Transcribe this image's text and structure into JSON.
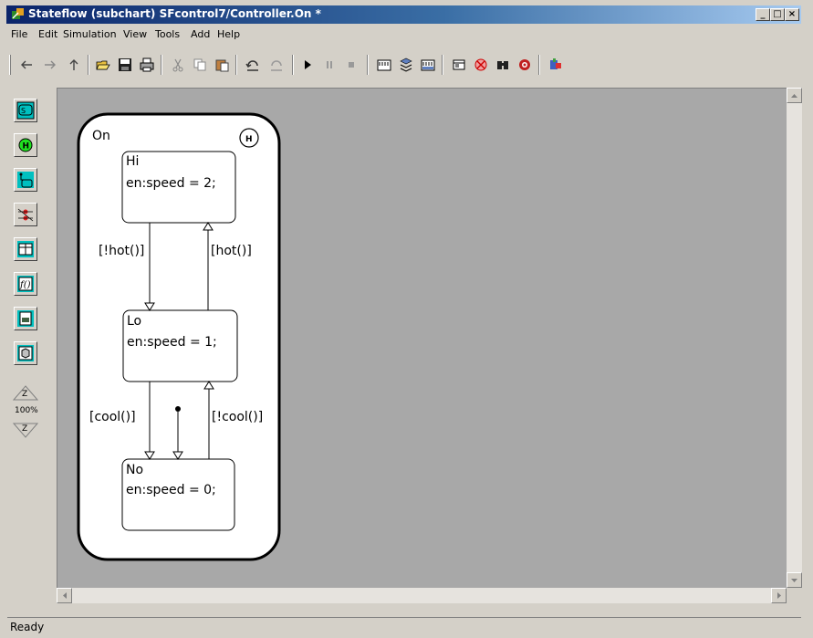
{
  "window": {
    "title": "Stateflow (subchart) SFcontrol7/Controller.On *"
  },
  "menu": [
    "File",
    "Edit",
    "Simulation",
    "View",
    "Tools",
    "Add",
    "Help"
  ],
  "palette": {
    "zoom_label": "100%",
    "zoom_in": "Z",
    "zoom_out": "Z"
  },
  "chart": {
    "superstate": {
      "label": "On",
      "history": "H"
    },
    "states": [
      {
        "name": "Hi",
        "action": "en:speed = 2;"
      },
      {
        "name": "Lo",
        "action": "en:speed = 1;"
      },
      {
        "name": "No",
        "action": "en:speed = 0;"
      }
    ],
    "transitions": {
      "hi_to_lo": "[!hot()]",
      "lo_to_hi": "[hot()]",
      "lo_to_no": "[cool()]",
      "no_to_lo": "[!cool()]"
    }
  },
  "status": {
    "text": "Ready"
  }
}
